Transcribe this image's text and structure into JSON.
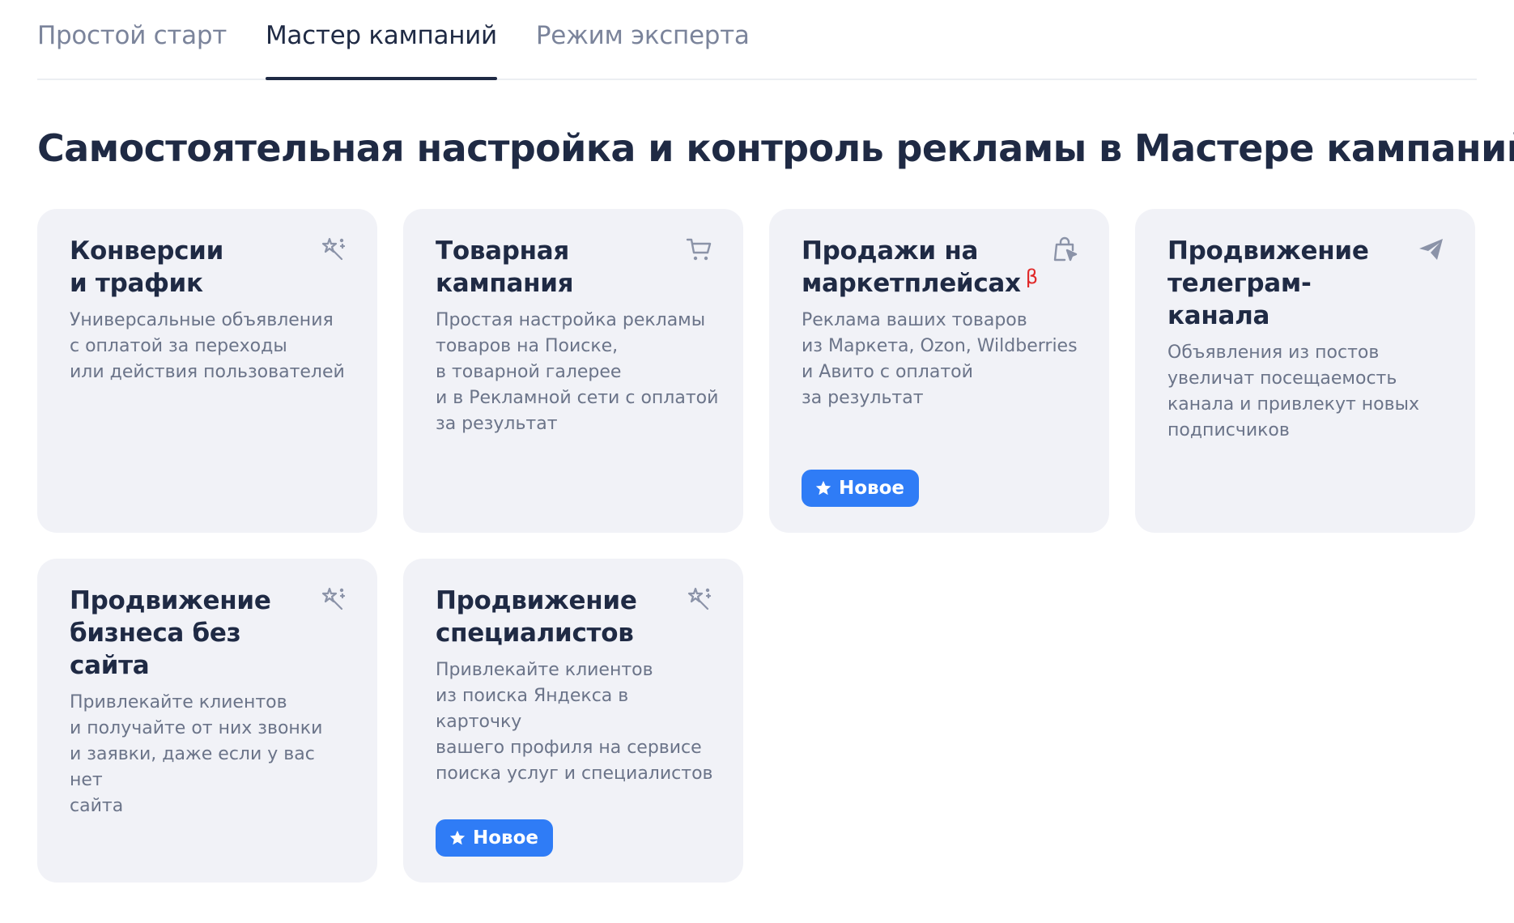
{
  "tabs": [
    {
      "label": "Простой старт",
      "active": false
    },
    {
      "label": "Мастер кампаний",
      "active": true
    },
    {
      "label": "Режим эксперта",
      "active": false
    }
  ],
  "heading": "Самостоятельная настройка и контроль рекламы в Мастере кампаний",
  "cards": [
    {
      "title": "Конверсии\nи трафик",
      "beta": "",
      "description": "Универсальные объявления\nс оплатой за переходы\nили действия пользователей",
      "icon": "magic-wand-icon",
      "badge": ""
    },
    {
      "title": "Товарная\nкампания",
      "beta": "",
      "description": "Простая настройка рекламы\nтоваров на Поиске,\nв товарной галерее\nи в Рекламной сети с оплатой\nза результат",
      "icon": "cart-icon",
      "badge": ""
    },
    {
      "title": "Продажи на\nмаркетплейсах",
      "beta": "β",
      "description": "Реклама ваших товаров\nиз Маркета, Ozon, Wildberries\nи Авито с оплатой\nза результат",
      "icon": "shopping-bag-cursor-icon",
      "badge": "Новое"
    },
    {
      "title": "Продвижение\nтелеграм-канала",
      "beta": "",
      "description": "Объявления из постов\nувеличат посещаемость\nканала и привлекут новых\nподписчиков",
      "icon": "paper-plane-icon",
      "badge": ""
    },
    {
      "title": "Продвижение\nбизнеса без сайта",
      "beta": "",
      "description": "Привлекайте клиентов\nи получайте от них звонки\nи заявки, даже если у вас нет\nсайта",
      "icon": "magic-wand-icon",
      "badge": ""
    },
    {
      "title": "Продвижение\nспециалистов",
      "beta": "",
      "description": "Привлекайте клиентов\nиз поиска Яндекса в карточку\nвашего профиля на сервисе\nпоиска услуг и специалистов",
      "icon": "magic-wand-icon",
      "badge": "Новое"
    }
  ],
  "colors": {
    "text_primary": "#1f2a44",
    "text_secondary": "#6b7489",
    "card_bg": "#f1f2f7",
    "badge_bg": "#2f7cf6",
    "beta": "#e12a2a",
    "icon": "#8b93a8"
  }
}
